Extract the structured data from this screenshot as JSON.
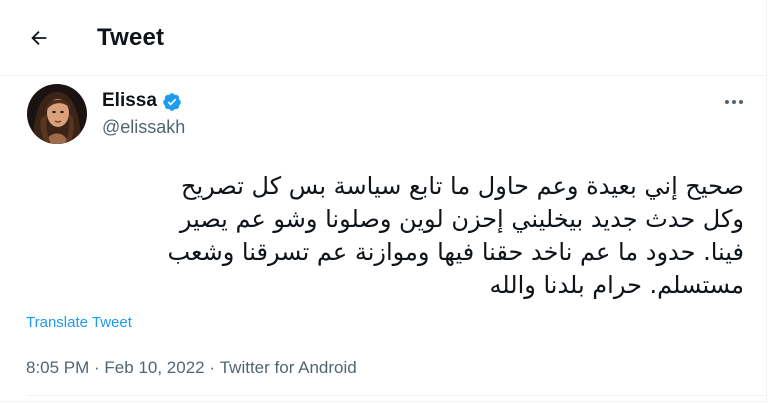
{
  "header": {
    "title": "Tweet",
    "back_icon": "arrow-left-icon"
  },
  "author": {
    "display_name": "Elissa",
    "handle": "@elissakh",
    "verified_icon": "verified-badge-icon",
    "verified_color": "#1d9bf0"
  },
  "tweet": {
    "text_lines": [
      "صحيح إني بعيدة وعم حاول ما تابع سياسة بس كل تصريح",
      "وكل حدث جديد بيخليني إحزن لوين وصلونا وشو عم يصير",
      "فينا. حدود ما عم ناخد حقنا فيها وموازنة عم تسرقنا وشعب",
      "مستسلم. حرام بلدنا والله"
    ],
    "translate_label": "Translate Tweet"
  },
  "meta": {
    "time": "8:05 PM",
    "separator": " · ",
    "date": "Feb 10, 2022",
    "source": "Twitter for Android"
  },
  "colors": {
    "accent": "#1d9bf0",
    "secondary_text": "#536471",
    "divider": "#eff3f4"
  },
  "icons": {
    "more": "more-options-icon"
  }
}
